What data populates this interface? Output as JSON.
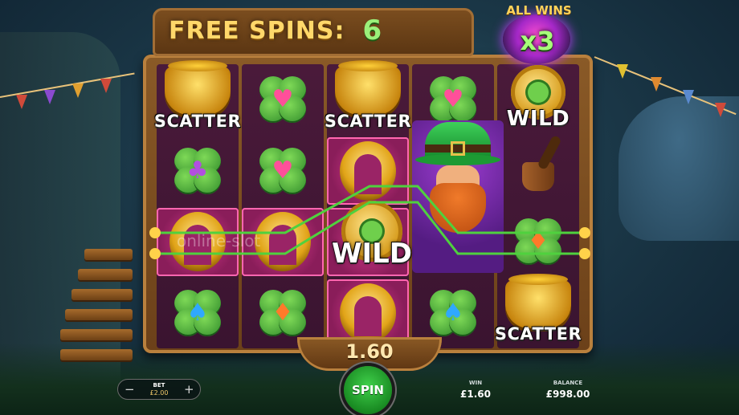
{
  "hud": {
    "free_spins_label": "FREE SPINS:",
    "free_spins_count": "6",
    "multiplier_label": "ALL WINS",
    "multiplier_value": "x3"
  },
  "grid": {
    "columns": [
      [
        "SCATTER",
        "club",
        "diamond-horseshoe",
        "spade"
      ],
      [
        "heart",
        "heart",
        "horseshoe",
        "diamond"
      ],
      [
        "SCATTER",
        "horseshoe",
        "WILD",
        "horseshoe"
      ],
      [
        "heart",
        "leprechaun",
        "leprechaun",
        "spade"
      ],
      [
        "WILD",
        "pipe",
        "diamond",
        "SCATTER"
      ]
    ],
    "labels": {
      "scatter": "SCATTER",
      "wild": "WILD"
    }
  },
  "watermark": "online-slot",
  "win_plaque": {
    "amount": "1.60"
  },
  "controls": {
    "bet_label": "BET",
    "bet_value": "£2.00",
    "bet_minus": "−",
    "bet_plus": "+",
    "spin_label": "SPIN",
    "win_label": "WIN",
    "win_value": "£1.60",
    "balance_label": "BALANCE",
    "balance_value": "£998.00"
  },
  "colors": {
    "payline": "#4fd13e",
    "highlight": "#c9307a",
    "frame": "#7a4a1e"
  }
}
